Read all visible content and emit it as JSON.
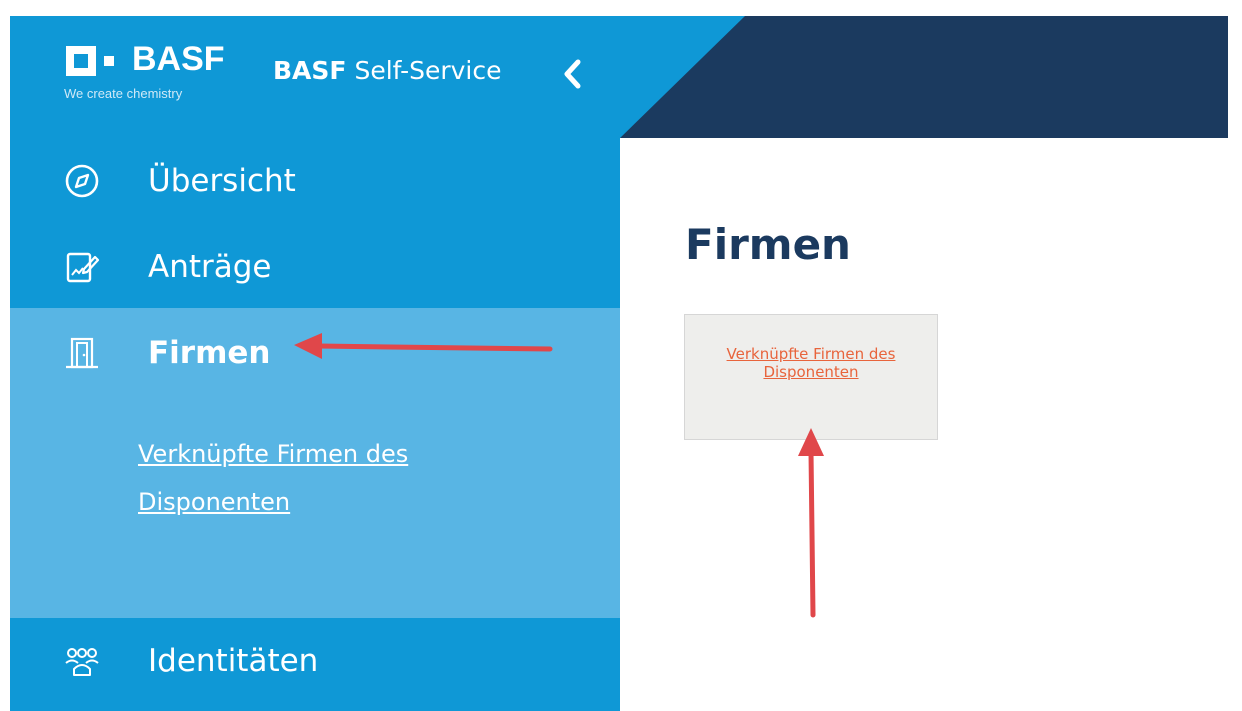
{
  "header": {
    "logo_word": "BASF",
    "logo_tagline": "We create chemistry",
    "app_title_brand": "BASF",
    "app_title_rest": " Self-Service",
    "collapse_icon": "chevron-left-icon"
  },
  "sidebar": {
    "items": [
      {
        "label": "Übersicht",
        "icon": "compass-icon"
      },
      {
        "label": "Anträge",
        "icon": "document-edit-icon"
      },
      {
        "label": "Firmen",
        "icon": "building-door-icon",
        "active": true
      },
      {
        "label": "Identitäten",
        "icon": "users-icon"
      }
    ],
    "sub_link": "Verknüpfte Firmen des Disponenten"
  },
  "main": {
    "title": "Firmen",
    "tile_link": "Verknüpfte Firmen des Disponenten"
  },
  "colors": {
    "sidebar_blue": "#0f98d6",
    "active_blue": "#58b5e4",
    "header_navy": "#1b3a5f",
    "link_orange": "#e8643c",
    "annotation_red": "#e0474a"
  }
}
